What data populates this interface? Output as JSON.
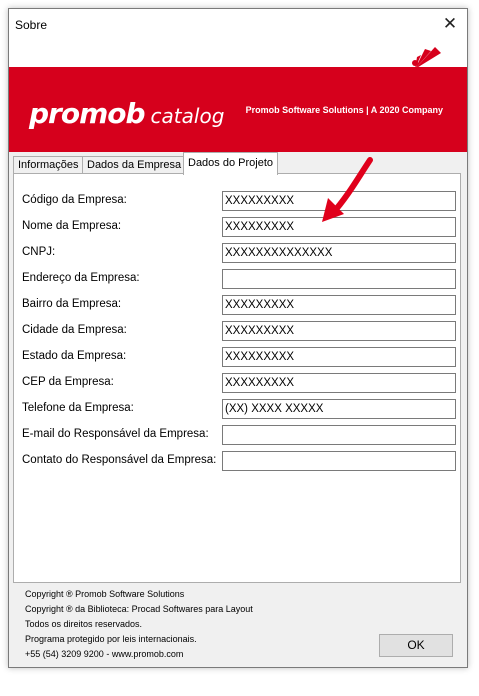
{
  "window": {
    "title": "Sobre",
    "close_symbol": "✕"
  },
  "banner": {
    "brand": "promob",
    "product": "catalog",
    "tagline": "Promob Software Solutions | A 2020 Company",
    "accent_color": "#d6001c"
  },
  "tabs": [
    {
      "label": "Informações",
      "active": false
    },
    {
      "label": "Dados da Empresa",
      "active": false
    },
    {
      "label": "Dados do Projeto",
      "active": true
    }
  ],
  "fields": [
    {
      "label": "Código da Empresa:",
      "value": "XXXXXXXXX"
    },
    {
      "label": "Nome da Empresa:",
      "value": "XXXXXXXXX"
    },
    {
      "label": "CNPJ:",
      "value": "XXXXXXXXXXXXXX"
    },
    {
      "label": "Endereço da Empresa:",
      "value": ""
    },
    {
      "label": "Bairro da Empresa:",
      "value": "XXXXXXXXX"
    },
    {
      "label": "Cidade da Empresa:",
      "value": "XXXXXXXXX"
    },
    {
      "label": "Estado da Empresa:",
      "value": "XXXXXXXXX"
    },
    {
      "label": "CEP da Empresa:",
      "value": "XXXXXXXXX"
    },
    {
      "label": "Telefone da Empresa:",
      "value": "(XX) XXXX XXXXX"
    },
    {
      "label": "E-mail do Responsável da Empresa:",
      "value": ""
    },
    {
      "label": "Contato do Responsável da Empresa:",
      "value": ""
    }
  ],
  "footer": {
    "lines": [
      "Copyright ® Promob Software Solutions",
      "Copyright ® da Biblioteca: Procad Softwares para Layout",
      "Todos os direitos reservados.",
      "Programa protegido por leis internacionais.",
      "+55 (54) 3209 9200  -  www.promob.com"
    ]
  },
  "ok_label": "OK",
  "annotation": {
    "icon": "red-arrow-icon",
    "color": "#e0001b"
  }
}
